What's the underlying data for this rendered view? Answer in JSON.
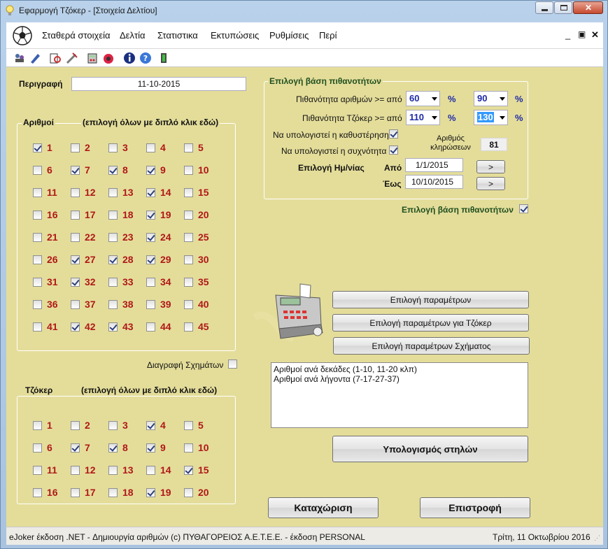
{
  "window": {
    "title": "Εφαρμογή Τζόκερ - [Στοιχεία Δελτίου]"
  },
  "menu": [
    "Σταθερά στοιχεία",
    "Δελτία",
    "Στατιστικα",
    "Εκτυπώσεις",
    "Ρυθμίσεις",
    "Περί"
  ],
  "toolbar_icons": [
    "players-icon",
    "pen-icon",
    "print-preview-icon",
    "tools-icon",
    "calculator-icon",
    "lottery-icon",
    "info-icon",
    "help-icon",
    "exit-icon"
  ],
  "description": {
    "label": "Περιγραφή",
    "value": "11-10-2015"
  },
  "numbers": {
    "header_left": "Αριθμοί",
    "header_right": "(επιλογή όλων με διπλό κλικ εδώ)",
    "items": [
      {
        "n": "1",
        "checked": true
      },
      {
        "n": "2",
        "checked": false
      },
      {
        "n": "3",
        "checked": false
      },
      {
        "n": "4",
        "checked": false
      },
      {
        "n": "5",
        "checked": false
      },
      {
        "n": "6",
        "checked": false
      },
      {
        "n": "7",
        "checked": true
      },
      {
        "n": "8",
        "checked": true
      },
      {
        "n": "9",
        "checked": true
      },
      {
        "n": "10",
        "checked": false
      },
      {
        "n": "11",
        "checked": false
      },
      {
        "n": "12",
        "checked": false
      },
      {
        "n": "13",
        "checked": false
      },
      {
        "n": "14",
        "checked": true
      },
      {
        "n": "15",
        "checked": false
      },
      {
        "n": "16",
        "checked": false
      },
      {
        "n": "17",
        "checked": false
      },
      {
        "n": "18",
        "checked": false
      },
      {
        "n": "19",
        "checked": true
      },
      {
        "n": "20",
        "checked": false
      },
      {
        "n": "21",
        "checked": false
      },
      {
        "n": "22",
        "checked": false
      },
      {
        "n": "23",
        "checked": false
      },
      {
        "n": "24",
        "checked": true
      },
      {
        "n": "25",
        "checked": false
      },
      {
        "n": "26",
        "checked": false
      },
      {
        "n": "27",
        "checked": true
      },
      {
        "n": "28",
        "checked": true
      },
      {
        "n": "29",
        "checked": true
      },
      {
        "n": "30",
        "checked": false
      },
      {
        "n": "31",
        "checked": false
      },
      {
        "n": "32",
        "checked": true
      },
      {
        "n": "33",
        "checked": false
      },
      {
        "n": "34",
        "checked": false
      },
      {
        "n": "35",
        "checked": false
      },
      {
        "n": "36",
        "checked": false
      },
      {
        "n": "37",
        "checked": false
      },
      {
        "n": "38",
        "checked": false
      },
      {
        "n": "39",
        "checked": false
      },
      {
        "n": "40",
        "checked": false
      },
      {
        "n": "41",
        "checked": false
      },
      {
        "n": "42",
        "checked": true
      },
      {
        "n": "43",
        "checked": true
      },
      {
        "n": "44",
        "checked": false
      },
      {
        "n": "45",
        "checked": false
      }
    ]
  },
  "delete_shapes": {
    "label": "Διαγραφή Σχημάτων",
    "checked": false
  },
  "joker": {
    "header_left": "Τζόκερ",
    "header_right": "(επιλογή όλων με διπλό κλικ εδώ)",
    "items": [
      {
        "n": "1",
        "checked": false
      },
      {
        "n": "2",
        "checked": false
      },
      {
        "n": "3",
        "checked": false
      },
      {
        "n": "4",
        "checked": true
      },
      {
        "n": "5",
        "checked": false
      },
      {
        "n": "6",
        "checked": false
      },
      {
        "n": "7",
        "checked": true
      },
      {
        "n": "8",
        "checked": true
      },
      {
        "n": "9",
        "checked": true
      },
      {
        "n": "10",
        "checked": false
      },
      {
        "n": "11",
        "checked": false
      },
      {
        "n": "12",
        "checked": false
      },
      {
        "n": "13",
        "checked": false
      },
      {
        "n": "14",
        "checked": false
      },
      {
        "n": "15",
        "checked": true
      },
      {
        "n": "16",
        "checked": false
      },
      {
        "n": "17",
        "checked": false
      },
      {
        "n": "18",
        "checked": false
      },
      {
        "n": "19",
        "checked": true
      },
      {
        "n": "20",
        "checked": false
      }
    ]
  },
  "probability": {
    "group_title": "Επιλογή βάση πιθανοτήτων",
    "numbers_label": "Πιθανότητα αριθμών >= από",
    "numbers_from": "60",
    "numbers_to": "90",
    "joker_label": "Πιθανότητα Τζόκερ >= από",
    "joker_from": "110",
    "joker_to": "130",
    "percent": "%",
    "delay_label": "Να υπολογιστεί η καθυστέρηση",
    "delay_checked": true,
    "freq_label": "Να υπολογιστεί η συχνότητα",
    "freq_checked": true,
    "draws_label": "Αριθμός κληρώσεων",
    "draws_value": "81",
    "date_label": "Επιλογή Ημ/νίας",
    "from_label": "Από",
    "from_value": "1/1/2015",
    "to_label": "Έως",
    "to_value": "10/10/2015",
    "arrow": ">"
  },
  "probability_toggle": {
    "label": "Επιλογή βάση πιθανοτήτων",
    "checked": true
  },
  "buttons": {
    "params": "Επιλογή παραμέτρων",
    "joker_params": "Επιλογή παραμέτρων για Τζόκερ",
    "shape_params": "Επιλογή παραμέτρων Σχήματος",
    "calc": "Υπολογισμός στηλών",
    "save": "Καταχώριση",
    "back": "Επιστροφή"
  },
  "shape_list": [
    "Αριθμοί ανά δεκάδες (1-10, 11-20 κλπ)",
    "Αριθμοί ανά λήγοντα (7-17-27-37)"
  ],
  "status": {
    "left": "eJoker έκδοση .NET  - Δημιουργία αριθμών  (c) ΠΥΘΑΓΟΡΕΙΟΣ  Α.Ε.Τ.Ε.Ε.  - έκδοση PERSONAL",
    "right": "Τρίτη, 11 Οκτωβρίου 2016"
  },
  "colors": {
    "client_bg": "#e4dd9a",
    "number_red": "#b01818",
    "accent_blue": "#1e2aa8"
  }
}
